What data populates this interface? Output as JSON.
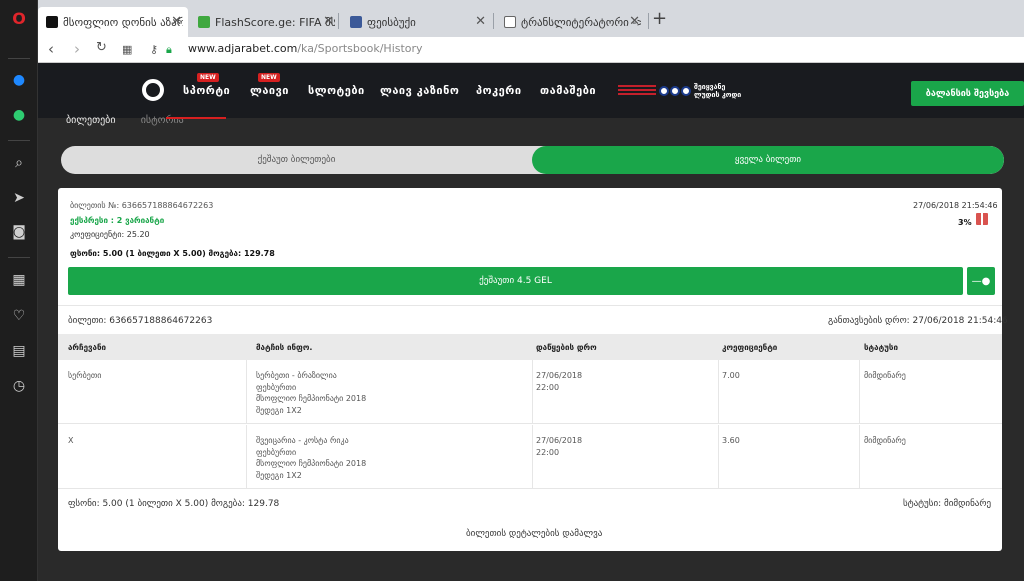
{
  "browser": {
    "tabs": [
      {
        "title": "მსოფლიო დონის აზარ"
      },
      {
        "title": "FlashScore.ge: FIFA მსოფ"
      },
      {
        "title": "ფეისბუქი"
      },
      {
        "title": "ტრანსლიტერატორი -> თ"
      }
    ],
    "url_host": "www.adjarabet.com",
    "url_path": "/ka/Sportsbook/History"
  },
  "site": {
    "nav": [
      "სპორტი",
      "ლაივი",
      "სლოტები",
      "ლაივ კაზინო",
      "პოკერი",
      "თამაშები"
    ],
    "new_badge": "NEW",
    "promo": "შეიყვანე\nლუდის კოდი",
    "cta": "ბალანსის შევსება"
  },
  "page": {
    "subtab_1": "ბილეთები",
    "subtab_2": "ისტორია",
    "seg_left": "ქეშაუთ ბილეთები",
    "seg_right": "ყველა ბილეთი"
  },
  "ticket": {
    "number_line": "ბილეთის №: 636657188864672263",
    "express_line": "ექსპრესი : 2 ვარიანტი",
    "coef_line": "კოეფიციენტი: 25.20",
    "stake_line": "ფსონი: 5.00 (1 ბილეთი X 5.00)  მოგება: 129.78",
    "date": "27/06/2018 21:54:46",
    "percent": "3%",
    "cashout": "ქეშაუთი 4.5 GEL",
    "cashout_toggle": "—●",
    "ticket_label": "ბილეთი: 636657188864672263",
    "placed_label": "განთავსების დრო: 27/06/2018 21:54:46",
    "headers": [
      "არჩევანი",
      "მატჩის ინფო.",
      "დაწყების დრო",
      "კოეფიციენტი",
      "სტატუსი"
    ],
    "rows": [
      {
        "choice": "სერბეთი",
        "info1": "სერბეთი - ბრაზილია",
        "info2": "ფეხბურთი",
        "info3": "მსოფლიო ჩემპიონატი 2018",
        "info4": "შედეგი 1X2",
        "date": "27/06/2018",
        "time": "22:00",
        "coef": "7.00",
        "status": "მიმდინარე"
      },
      {
        "choice": "X",
        "info1": "შვეიცარია - კოსტა რიკა",
        "info2": "ფეხბურთი",
        "info3": "მსოფლიო ჩემპიონატი 2018",
        "info4": "შედეგი 1X2",
        "date": "27/06/2018",
        "time": "22:00",
        "coef": "3.60",
        "status": "მიმდინარე"
      }
    ],
    "footer_left": "ფსონი: 5.00 (1 ბილეთი X 5.00)  მოგება: 129.78",
    "footer_status": "სტატუსი: მიმდინარე",
    "hide_details": "ბილეთის დეტალების დამალვა"
  }
}
